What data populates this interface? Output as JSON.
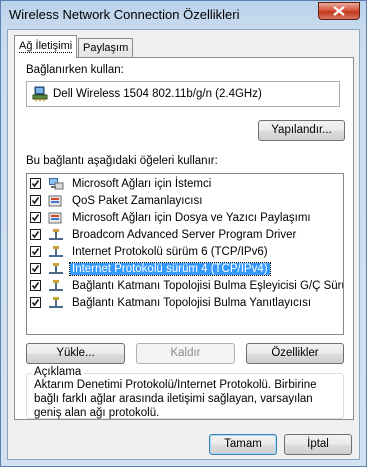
{
  "window": {
    "title": "Wireless Network Connection Özellikleri"
  },
  "tabs": [
    {
      "label": "Ağ İletişimi",
      "active": true
    },
    {
      "label": "Paylaşım",
      "active": false
    }
  ],
  "connect_using": {
    "label": "Bağlanırken kullan:",
    "adapter": "Dell Wireless 1504 802.11b/g/n (2.4GHz)",
    "configure_button": "Yapılandır..."
  },
  "items_section": {
    "label": "Bu bağlantı aşağıdaki öğeleri kullanır:",
    "items": [
      {
        "label": "Microsoft Ağları için İstemci",
        "checked": true,
        "icon": "client-icon"
      },
      {
        "label": "QoS Paket Zamanlayıcısı",
        "checked": true,
        "icon": "service-icon"
      },
      {
        "label": "Microsoft Ağları için Dosya ve Yazıcı Paylaşımı",
        "checked": true,
        "icon": "service-icon"
      },
      {
        "label": "Broadcom Advanced Server Program Driver",
        "checked": true,
        "icon": "protocol-icon"
      },
      {
        "label": "Internet Protokolü sürüm 6 (TCP/IPv6)",
        "checked": true,
        "icon": "protocol-icon"
      },
      {
        "label": "Internet Protokolü sürüm 4 (TCP/IPv4)",
        "checked": true,
        "icon": "protocol-icon",
        "selected": true
      },
      {
        "label": "Bağlantı Katmanı Topolojisi Bulma Eşleyicisi G/Ç Sürücü...",
        "checked": true,
        "icon": "protocol-icon"
      },
      {
        "label": "Bağlantı Katmanı Topolojisi Bulma Yanıtlayıcısı",
        "checked": true,
        "icon": "protocol-icon"
      }
    ]
  },
  "action_buttons": {
    "install": "Yükle...",
    "uninstall": "Kaldır",
    "properties": "Özellikler"
  },
  "description": {
    "title": "Açıklama",
    "text": "Aktarım Denetimi Protokolü/Internet Protokolü. Birbirine bağlı farklı ağlar arasında iletişimi sağlayan, varsayılan geniş alan ağı protokolü."
  },
  "dialog_buttons": {
    "ok": "Tamam",
    "cancel": "İptal"
  },
  "colors": {
    "selection": "#3399ff",
    "frame": "#c9dcef"
  }
}
